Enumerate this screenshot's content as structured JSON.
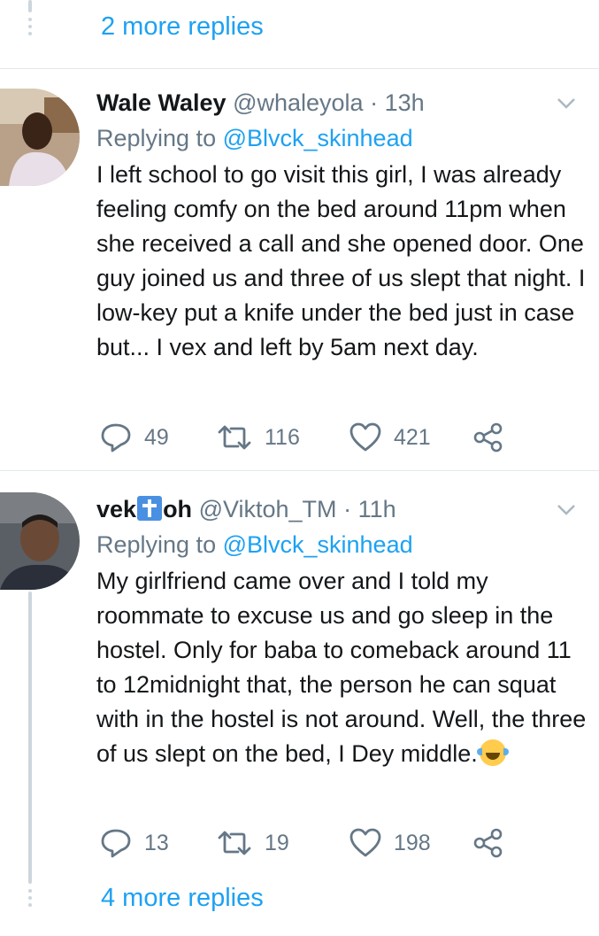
{
  "top": {
    "more_replies": "2 more replies"
  },
  "tweets": [
    {
      "name": "Wale Waley",
      "handle": "@whaleyola",
      "separator": "·",
      "time": "13h",
      "replying_prefix": "Replying to ",
      "replying_to": "@Blvck_skinhead",
      "text": "I left school to go visit this girl, I was already feeling comfy on the bed around 11pm when she received a call and she opened door. One guy joined us and three of us slept that night. I low-key put a knife under the bed just in case but... I vex and left by 5am next day.",
      "replies": "49",
      "retweets": "116",
      "likes": "421"
    },
    {
      "name_part1": "vek",
      "name_part2": "oh",
      "handle": "@Viktoh_TM",
      "separator": "·",
      "time": "11h",
      "replying_prefix": "Replying to ",
      "replying_to": "@Blvck_skinhead",
      "text": "My girlfriend came over and I told my roommate to excuse us and go sleep in the hostel. Only for baba to comeback around 11 to 12midnight that, the person he can squat with in the hostel is not around. Well, the three of us slept on the bed, I Dey middle.",
      "replies": "13",
      "retweets": "19",
      "likes": "198"
    }
  ],
  "bottom": {
    "more_replies": "4 more replies"
  },
  "icons": {
    "reply": "reply-icon",
    "retweet": "retweet-icon",
    "like": "heart-icon",
    "share": "share-icon",
    "caret": "chevron-down-icon",
    "name_emoji": "latin-cross-emoji",
    "text_emoji": "tears-of-joy-emoji"
  },
  "colors": {
    "accent": "#1da1f2",
    "muted": "#657786",
    "line": "#ccd6dd"
  }
}
